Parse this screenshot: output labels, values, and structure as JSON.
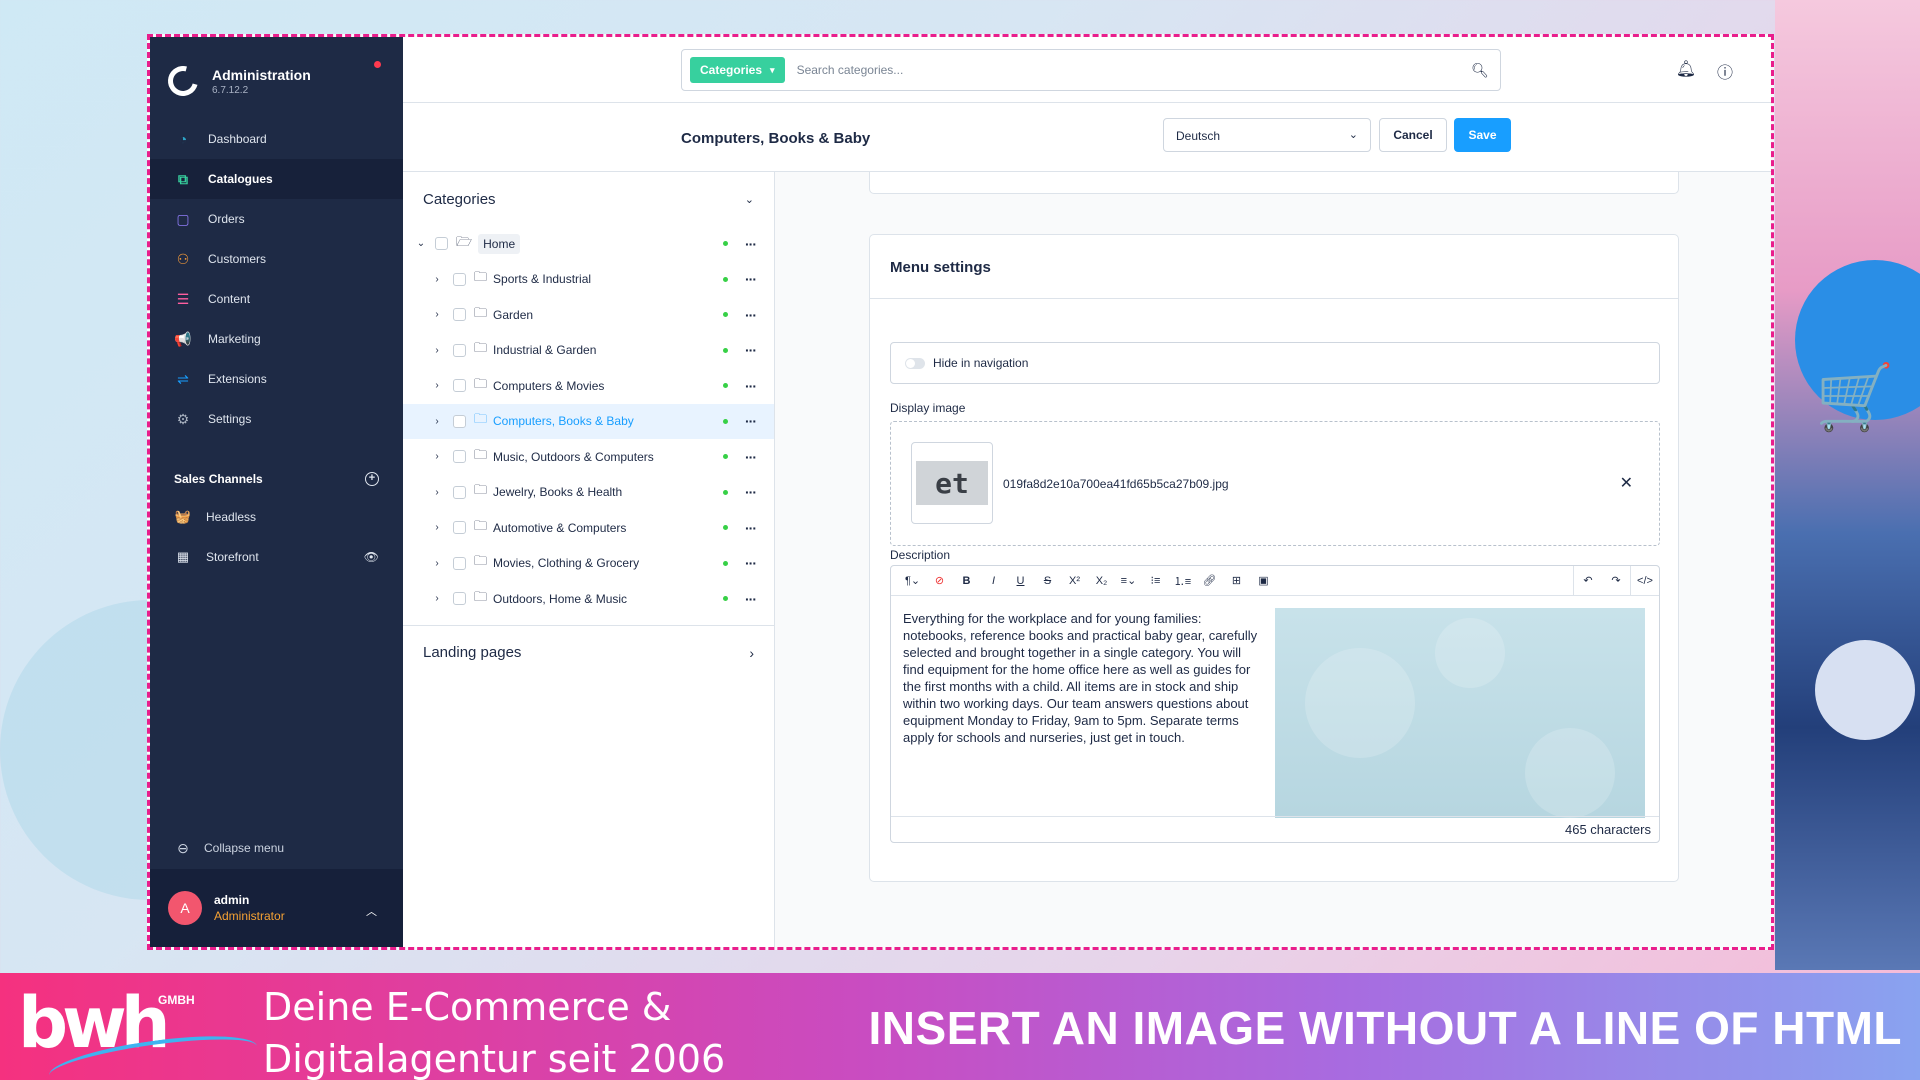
{
  "brand": {
    "title": "Administration",
    "version": "6.7.12.2"
  },
  "nav": [
    {
      "label": "Dashboard",
      "icon": "dashboard-icon",
      "color": "#2da4c6"
    },
    {
      "label": "Catalogues",
      "icon": "catalogues-icon",
      "color": "#37d09e",
      "active": true
    },
    {
      "label": "Orders",
      "icon": "orders-icon",
      "color": "#8f7cf7"
    },
    {
      "label": "Customers",
      "icon": "customers-icon",
      "color": "#f49a3a"
    },
    {
      "label": "Content",
      "icon": "content-icon",
      "color": "#ff5ea0"
    },
    {
      "label": "Marketing",
      "icon": "marketing-icon",
      "color": "#ffd230"
    },
    {
      "label": "Extensions",
      "icon": "extensions-icon",
      "color": "#189eff"
    },
    {
      "label": "Settings",
      "icon": "settings-icon",
      "color": "#a8b1bf"
    }
  ],
  "sales_channels": {
    "heading": "Sales Channels",
    "items": [
      {
        "label": "Headless",
        "icon": "basket-icon"
      },
      {
        "label": "Storefront",
        "icon": "storefront-icon"
      }
    ]
  },
  "collapse_label": "Collapse menu",
  "user": {
    "initial": "A",
    "name": "admin",
    "role": "Administrator"
  },
  "search": {
    "type_label": "Categories",
    "placeholder": "Search categories..."
  },
  "page": {
    "title": "Computers, Books & Baby",
    "language": "Deutsch",
    "cancel_label": "Cancel",
    "save_label": "Save"
  },
  "tree": {
    "heading": "Categories",
    "root": "Home",
    "items": [
      "Sports & Industrial",
      "Garden",
      "Industrial & Garden",
      "Computers & Movies",
      "Computers, Books & Baby",
      "Music, Outdoors & Computers",
      "Jewelry, Books & Health",
      "Automotive & Computers",
      "Movies, Clothing & Grocery",
      "Outdoors, Home & Music"
    ],
    "selected_index": 4,
    "landing_pages": "Landing pages"
  },
  "menu_settings": {
    "title": "Menu settings",
    "hide_in_navigation": "Hide in navigation",
    "display_image_label": "Display image",
    "image_thumb_text": "et",
    "image_filename": "019fa8d2e10a700ea41fd65b5ca27b09.jpg",
    "description_label": "Description",
    "description_text": "Everything for the workplace and for young families: notebooks, reference books and practical baby gear, carefully selected and brought together in a single category. You will find equipment for the home office here as well as guides for the first months with a child. All items are in stock and ship within two working days. Our team answers questions about equipment Monday to Friday, 9am to 5pm. Separate terms apply for schools and nurseries, just get in touch.",
    "char_count": "465 characters"
  },
  "banner": {
    "logo_text": "bwh",
    "logo_gmbh": "GMBH",
    "tagline_line1": "Deine E-Commerce &",
    "tagline_line2": "Digitalagentur seit 2006",
    "headline": "INSERT AN IMAGE WITHOUT A LINE OF HTML"
  }
}
